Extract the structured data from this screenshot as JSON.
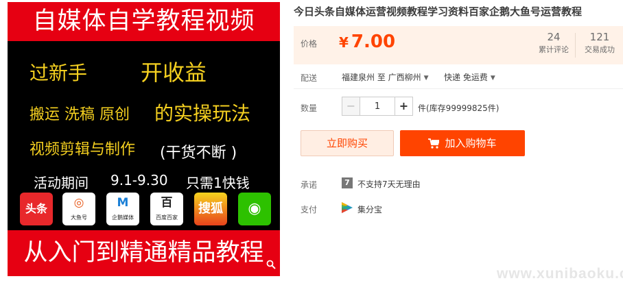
{
  "promo": {
    "top_banner": "自媒体自学教程视频",
    "line1": "过新手",
    "line2": "开收益",
    "line3": "搬运 洗稿 原创",
    "line4": "的实操玩法",
    "line5": "视频剪辑与制作",
    "line6": "(干货不断 )",
    "event_label": "活动期间",
    "event_dates": "9.1-9.30",
    "event_price": "只需1快钱",
    "apps": [
      {
        "glyph": "头条",
        "caption": ""
      },
      {
        "glyph": "◎",
        "caption": "大鱼号"
      },
      {
        "glyph": "M",
        "caption": "企鹅媒体"
      },
      {
        "glyph": "百",
        "caption": "百度百家"
      },
      {
        "glyph": "搜狐",
        "caption": ""
      },
      {
        "glyph": "◉",
        "caption": ""
      }
    ],
    "bottom_banner": "从入门到精通精品教程"
  },
  "product": {
    "title": "今日头条自媒体运营视频教程学习资料百家企鹅大鱼号运营教程",
    "price_label": "价格",
    "currency": "¥",
    "price": "7.00",
    "reviews_count": "24",
    "reviews_label": "累计评论",
    "deals_count": "121",
    "deals_label": "交易成功",
    "shipping_label": "配送",
    "shipping_from": "福建泉州 至",
    "shipping_to": "广西柳州",
    "shipping_method": "快递 免运费",
    "quantity_label": "数量",
    "quantity_value": "1",
    "stock": "件(库存99999825件)",
    "buy_now": "立即购买",
    "add_to_cart": "加入购物车",
    "promise_label": "承诺",
    "promise_text": "不支持7天无理由",
    "payment_label": "支付",
    "payment_text": "集分宝"
  },
  "watermark": "www.xunibaoku.com",
  "colors": {
    "accent": "#ff4400",
    "promo_red": "#e60012",
    "price_bg": "#fff2e8"
  }
}
